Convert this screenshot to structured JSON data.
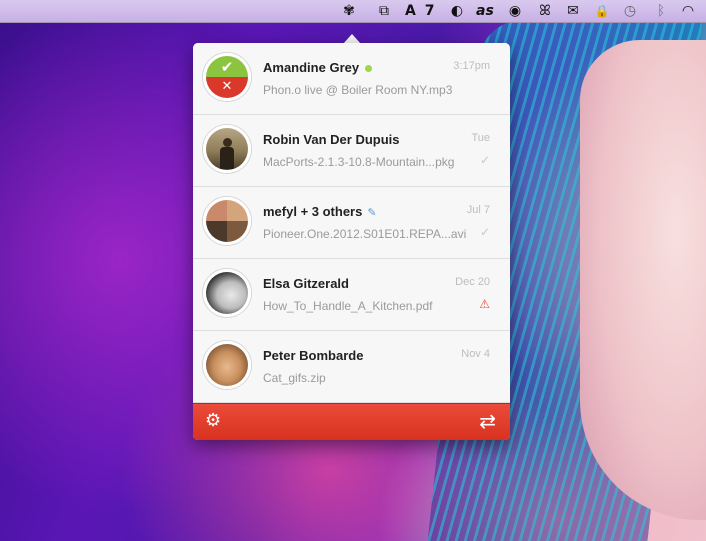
{
  "menubar": {
    "items": [
      {
        "icon": "flower-icon",
        "glyph": "✾"
      },
      {
        "icon": "window-stack-icon",
        "glyph": "⧉"
      },
      {
        "icon": "adobe-icon",
        "glyph": "A",
        "badge": "7"
      },
      {
        "icon": "moon-icon",
        "glyph": "◐"
      },
      {
        "icon": "lastfm-icon",
        "glyph": "as"
      },
      {
        "icon": "globe-icon",
        "glyph": "◉"
      },
      {
        "icon": "butterfly-icon",
        "glyph": "ꕤ"
      },
      {
        "icon": "mail-icon",
        "glyph": "✉"
      },
      {
        "icon": "lock-icon",
        "glyph": "🔒"
      },
      {
        "icon": "time-machine-icon",
        "glyph": "◷"
      },
      {
        "icon": "bluetooth-icon",
        "glyph": "ᛒ"
      },
      {
        "icon": "wifi-icon",
        "glyph": "◠"
      }
    ]
  },
  "transfers": [
    {
      "name": "Amandine Grey",
      "file": "Phon.o live @ Boiler Room NY.mp3",
      "time": "3:17pm",
      "online": true,
      "status_icon": "",
      "avatar": "accept-decline-avatar"
    },
    {
      "name": "Robin Van Der Dupuis",
      "file": "MacPorts-2.1.3-10.8-Mountain...pkg",
      "time": "Tue",
      "status_icon": "✓",
      "avatar": "robin-avatar"
    },
    {
      "name": "mefyl + 3 others",
      "file": "Pioneer.One.2012.S01E01.REPA...avi",
      "time": "Jul 7",
      "status_icon": "✓",
      "edit": true,
      "avatar": "group-avatar"
    },
    {
      "name": "Elsa Gitzerald",
      "file": "How_To_Handle_A_Kitchen.pdf",
      "time": "Dec 20",
      "status_icon": "⚠",
      "avatar": "elsa-avatar"
    },
    {
      "name": "Peter Bombarde",
      "file": "Cat_gifs.zip",
      "time": "Nov 4",
      "status_icon": "",
      "avatar": "peter-avatar"
    }
  ],
  "footer": {
    "settings_glyph": "⚙",
    "transfer_glyph": "⇄"
  },
  "colors": {
    "accent": "#e13d2a",
    "online": "#9bd64b",
    "warning": "#e64a3b"
  }
}
